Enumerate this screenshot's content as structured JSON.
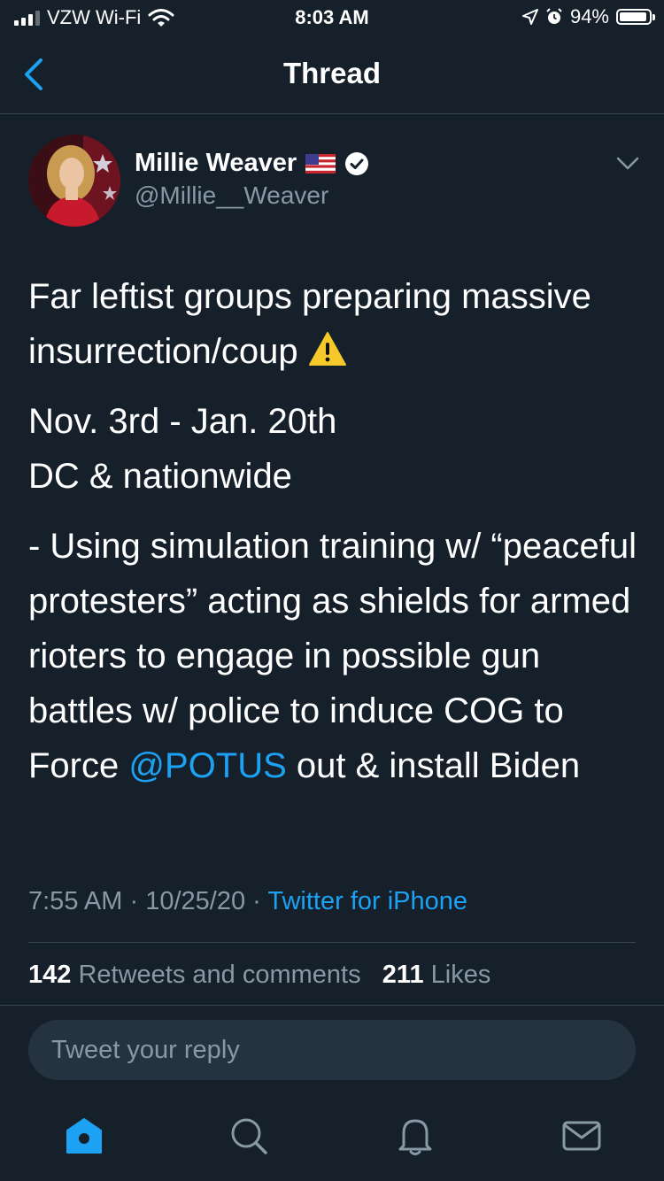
{
  "status_bar": {
    "carrier": "VZW Wi-Fi",
    "time": "8:03 AM",
    "battery": "94%",
    "battery_level": 0.94
  },
  "nav": {
    "title": "Thread"
  },
  "tweet": {
    "author_name": "Millie Weaver",
    "handle": "@Millie__Weaver",
    "verified": true,
    "flag": "us-flag",
    "line1": "Far leftist groups preparing massive insurrection/coup",
    "line1_emoji": "⚠️",
    "line2a": "Nov. 3rd - Jan. 20th",
    "line2b": "DC & nationwide",
    "line3_before": "- Using simulation training w/ “peaceful protesters” acting as shields for armed rioters to engage in possible gun battles w/ police to induce COG to Force ",
    "mention": "@POTUS",
    "line3_after": " out & install Biden",
    "time": "7:55 AM",
    "date": "10/25/20",
    "separator": "·",
    "source": "Twitter for iPhone",
    "retweets_count": "142",
    "retweets_label": "Retweets and comments",
    "likes_count": "211",
    "likes_label": "Likes"
  },
  "reply": {
    "placeholder": "Tweet your reply"
  },
  "tabs": [
    {
      "icon": "home-icon",
      "active": true
    },
    {
      "icon": "search-icon",
      "active": false
    },
    {
      "icon": "notifications-icon",
      "active": false
    },
    {
      "icon": "messages-icon",
      "active": false
    }
  ],
  "colors": {
    "background": "#15202b",
    "accent": "#1da1f2",
    "secondary_text": "#8899a6",
    "divider": "#38444d"
  }
}
